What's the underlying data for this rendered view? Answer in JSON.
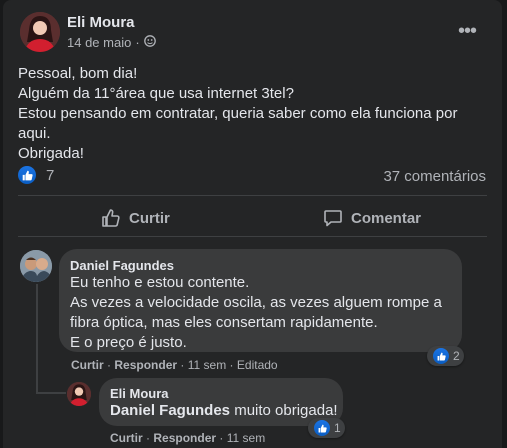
{
  "post": {
    "author": "Eli Moura",
    "date": "14 de maio",
    "separator": "·",
    "privacy_icon": "group-icon",
    "lines": [
      "Pessoal, bom dia!",
      "Alguém da 11°área que usa internet 3tel?",
      "Estou pensando em contratar, queria saber como ela funciona por",
      "aqui.",
      "Obrigada!"
    ],
    "reactions_count": "7",
    "comments_count": "37 comentários"
  },
  "actions": {
    "like_label": "Curtir",
    "comment_label": "Comentar"
  },
  "comments": [
    {
      "author": "Daniel Fagundes",
      "lines": [
        "Eu tenho e estou contente.",
        "As vezes a velocidade oscila, as vezes alguem rompe a",
        "fibra óptica, mas eles consertam rapidamente.",
        "E o preço é justo."
      ],
      "like": "Curtir",
      "reply": "Responder",
      "time": "11 sem",
      "edited": "Editado",
      "reactions": "2"
    }
  ],
  "reply": {
    "author": "Eli Moura",
    "mention": "Daniel Fagundes",
    "text": " muito obrigada!",
    "like": "Curtir",
    "reply": "Responder",
    "time": "11 sem",
    "reactions": "1"
  },
  "colors": {
    "background": "#18191a",
    "card": "#242526",
    "bubble": "#3a3b3c",
    "accent": "#1b74e4"
  }
}
